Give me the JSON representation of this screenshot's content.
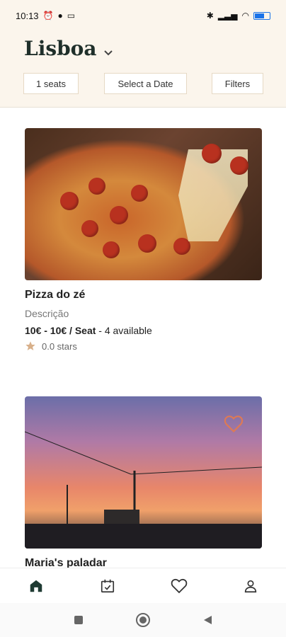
{
  "status_bar": {
    "time": "10:13"
  },
  "header": {
    "city": "Lisboa",
    "filters": [
      {
        "label": "1 seats"
      },
      {
        "label": "Select a Date"
      },
      {
        "label": "Filters"
      }
    ]
  },
  "cards": [
    {
      "title": "Pizza do zé",
      "description": "Descrição",
      "price": "10€ - 10€ / Seat",
      "availability": " - 4 available",
      "rating": "0.0 stars"
    },
    {
      "title": "Maria's paladar"
    }
  ],
  "colors": {
    "accent": "#1f3b33",
    "heart": "#e07a52",
    "star": "#d8b08a"
  }
}
